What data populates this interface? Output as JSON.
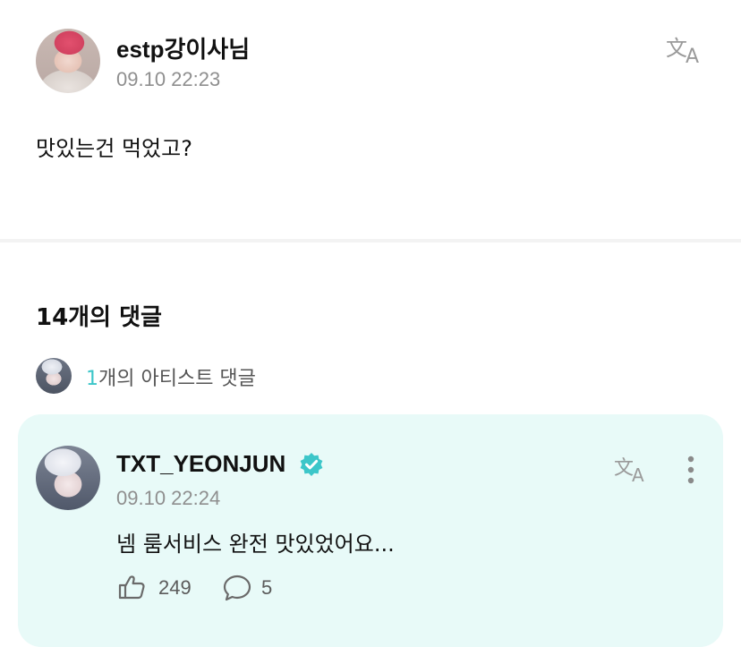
{
  "post": {
    "username": "estp강이사님",
    "timestamp": "09.10 22:23",
    "body": "맛있는건 먹었고?"
  },
  "comments": {
    "header": "14개의 댓글",
    "artist_count_number": "1",
    "artist_count_suffix": "개의 아티스트 댓글"
  },
  "artist_comment": {
    "username": "TXT_YEONJUN",
    "timestamp": "09.10 22:24",
    "body": "넴 룸서비스 완전 맛있었어요...",
    "likes": "249",
    "replies": "5"
  },
  "colors": {
    "accent": "#3cc6c9",
    "card_bg": "#e8faf8",
    "verified": "#3cc6c9"
  },
  "icons": [
    "translate-icon",
    "verified-badge-icon",
    "more-icon",
    "like-icon",
    "reply-icon"
  ]
}
